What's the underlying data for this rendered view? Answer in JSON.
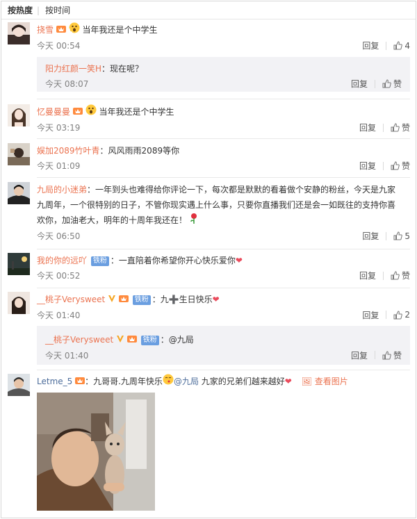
{
  "sort": {
    "hot": "按热度",
    "time": "按时间"
  },
  "labels": {
    "reply": "回复",
    "like": "赞",
    "view_image": "查看图片"
  },
  "comments": [
    {
      "user": "挠雪",
      "text": "当年我还是个中学生",
      "time": "今天 00:54",
      "likes": "4"
    },
    {
      "user": "阳力红颜一笑H",
      "text": "：现在呢？",
      "time": "今天 08:07",
      "likes": "赞"
    },
    {
      "user": "忆曼曼曼",
      "text": "当年我还是个中学生",
      "time": "今天 03:19",
      "likes": "赞"
    },
    {
      "user": "娱加2089竹叶青",
      "text": "：风风雨雨2089等你",
      "time": "今天 01:09",
      "likes": "赞"
    },
    {
      "user": "九局的小迷弟",
      "text_line1": "：一年到头也难得给你评论一下，每次都是默默的看着做个安静的粉丝，今天是九家",
      "text_line2": "九周年，一个很特别的日子，不管你现实遇上什么事，只要你直播我们还是会一如既往的支持你喜",
      "text_line3": "欢你，加油老大，明年的十周年我还在！",
      "time": "今天 06:50",
      "likes": "5"
    },
    {
      "user": "我的你的远吖",
      "tag": "铁粉",
      "text": "：一直陪着你希望你开心快乐爱你",
      "time": "今天 00:52",
      "likes": "赞"
    },
    {
      "user": "__桃子Verysweet",
      "tag": "铁粉",
      "text": "：九➕生日快乐",
      "time": "今天 01:40",
      "likes": "2"
    },
    {
      "user": "__桃子Verysweet",
      "tag": "铁粉",
      "text": "：@九局",
      "time": "今天 01:40",
      "likes": "赞"
    },
    {
      "user": "Letme_5",
      "text_a": "：九哥哥.九周年快乐",
      "mention": "@九局",
      "text_b": " 九家的兄弟们越来越好"
    }
  ],
  "colors": {
    "username": "#eb7350",
    "link": "#4d6d9b",
    "reply_bg": "#f2f2f5",
    "tag": "#6a9ee0",
    "heart": "#ea4b5c"
  }
}
